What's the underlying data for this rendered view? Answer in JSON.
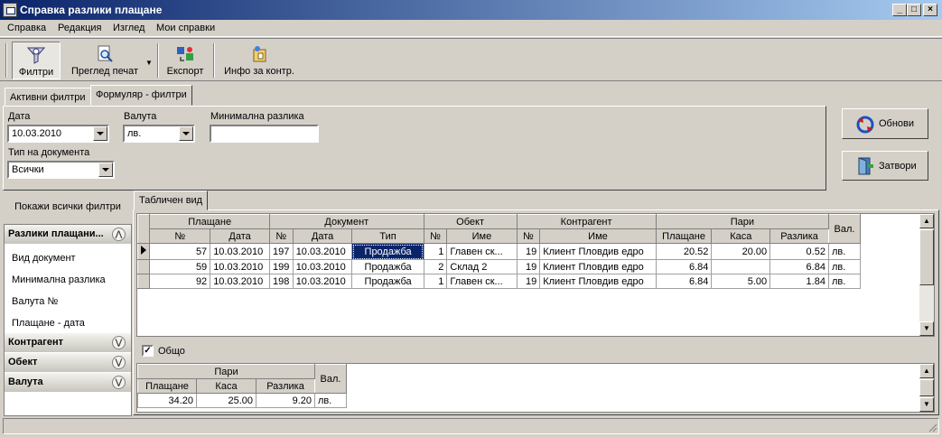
{
  "window": {
    "title": "Справка разлики плащане",
    "min": "_",
    "max": "□",
    "close": "×"
  },
  "menu": [
    "Справка",
    "Редакция",
    "Изглед",
    "Мои справки"
  ],
  "toolbar": {
    "filters": "Филтри",
    "print_preview": "Преглед печат",
    "export": "Експорт",
    "info": "Инфо за контр."
  },
  "tabs": {
    "active_filters": "Активни филтри",
    "form_filters": "Формуляр - филтри"
  },
  "form": {
    "date_label": "Дата",
    "date_value": "10.03.2010",
    "currency_label": "Валута",
    "currency_value": "лв.",
    "min_diff_label": "Минимална разлика",
    "min_diff_value": "",
    "doc_type_label": "Тип на документа",
    "doc_type_value": "Всички"
  },
  "buttons": {
    "refresh": "Обнови",
    "close": "Затвори"
  },
  "left_nav": {
    "show_all": "Покажи всички филтри",
    "groups": [
      {
        "title": "Разлики плащани...",
        "expanded": true,
        "items": [
          "Вид документ",
          "Минимална разлика",
          "Валута №",
          "Плащане - дата"
        ]
      },
      {
        "title": "Контрагент",
        "expanded": false
      },
      {
        "title": "Обект",
        "expanded": false
      },
      {
        "title": "Валута",
        "expanded": false
      }
    ]
  },
  "view_tab": "Табличен вид",
  "grid": {
    "group_headers": [
      "Плащане",
      "Документ",
      "Обект",
      "Контрагент",
      "Пари",
      "Вал."
    ],
    "sub_headers": [
      "№",
      "Дата",
      "№",
      "Дата",
      "Тип",
      "№",
      "Име",
      "№",
      "Име",
      "Плащане",
      "Каса",
      "Разлика"
    ],
    "rows": [
      [
        "57",
        "10.03.2010",
        "197",
        "10.03.2010",
        "Продажба",
        "1",
        "Главен ск...",
        "19",
        "Клиент Пловдив едро",
        "20.52",
        "20.00",
        "0.52",
        "лв."
      ],
      [
        "59",
        "10.03.2010",
        "199",
        "10.03.2010",
        "Продажба",
        "2",
        "Склад 2",
        "19",
        "Клиент Пловдив едро",
        "6.84",
        "",
        "6.84",
        "лв."
      ],
      [
        "92",
        "10.03.2010",
        "198",
        "10.03.2010",
        "Продажба",
        "1",
        "Главен ск...",
        "19",
        "Клиент Пловдив едро",
        "6.84",
        "5.00",
        "1.84",
        "лв."
      ]
    ]
  },
  "totals": {
    "checkbox_label": "Общо",
    "checked": true,
    "group_header": "Пари",
    "currency_header": "Вал.",
    "sub_headers": [
      "Плащане",
      "Каса",
      "Разлика"
    ],
    "row": [
      "34.20",
      "25.00",
      "9.20",
      "лв."
    ]
  }
}
